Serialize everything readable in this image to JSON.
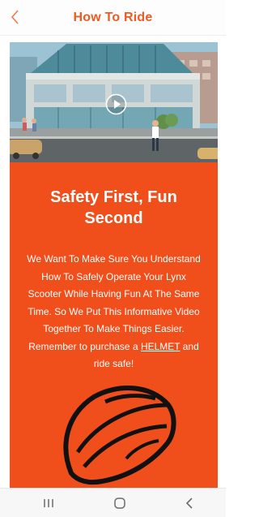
{
  "header": {
    "title": "How To Ride",
    "back_icon": "chevron-left-icon"
  },
  "video": {
    "play_icon": "play-icon"
  },
  "main": {
    "heading_line1": "Safety First, Fun",
    "heading_line2": "Second",
    "body_lines": [
      "We Want To Make Sure You Understand",
      "How To Safely Operate Your Lynx",
      "Scooter While Having Fun At The Same",
      "Time. So We Put This Informative Video",
      "Together To Make Things Easier."
    ],
    "reminder_prefix": "Remember to purchase a ",
    "helmet_link": "HELMET",
    "reminder_suffix": " and",
    "closing": "ride safe!"
  },
  "navbar": {
    "recents_icon": "recents-icon",
    "home_icon": "home-icon",
    "back_icon": "back-icon"
  },
  "colors": {
    "accent": "#ee5a21",
    "panel": "#f04e1a",
    "white": "#ffffff"
  }
}
